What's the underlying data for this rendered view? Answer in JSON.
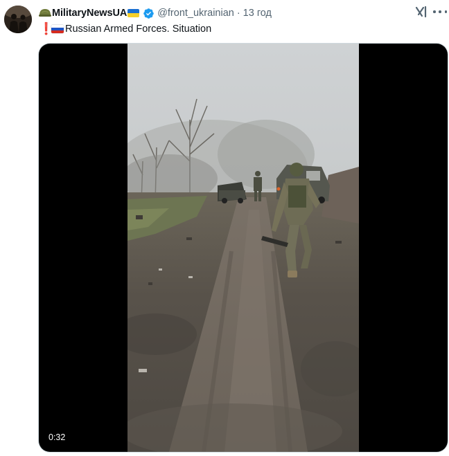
{
  "author": {
    "display_name": "MilitaryNewsUA",
    "handle": "@front_ukrainian",
    "separator": "·",
    "time": "13 год",
    "avatar_icon": "avatar-image",
    "verified_icon": "verified-badge-icon"
  },
  "tweet": {
    "exclamation": "❗",
    "text": "Russian Armed Forces. Situation"
  },
  "media": {
    "duration": "0:32"
  },
  "colors": {
    "verified": "#1d9bf0",
    "muted_text": "#536471",
    "exclamation": "#e2262b"
  }
}
